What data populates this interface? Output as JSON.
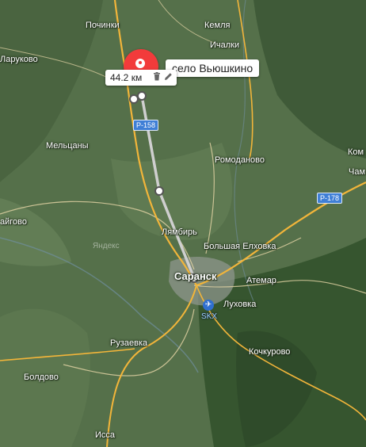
{
  "map": {
    "places": [
      {
        "id": "pochinki",
        "name": "Починки"
      },
      {
        "id": "kemlya",
        "name": "Кемля"
      },
      {
        "id": "ichalki",
        "name": "Ичалки"
      },
      {
        "id": "larukovo",
        "name": "Ларуково"
      },
      {
        "id": "meltsany",
        "name": "Мельцаны"
      },
      {
        "id": "romodanovo",
        "name": "Ромоданово"
      },
      {
        "id": "kom",
        "name": "Ком"
      },
      {
        "id": "cham",
        "name": "Чам"
      },
      {
        "id": "aygovo",
        "name": "айгово"
      },
      {
        "id": "lyambir",
        "name": "Лямбирь"
      },
      {
        "id": "bolshaya-elkovka",
        "name": "Большая Елховка"
      },
      {
        "id": "saransk",
        "name": "Саранск"
      },
      {
        "id": "atemar",
        "name": "Атемар"
      },
      {
        "id": "lukhovka",
        "name": "Луховка"
      },
      {
        "id": "ruzaevka",
        "name": "Рузаевка"
      },
      {
        "id": "kochkurovo",
        "name": "Кочкурово"
      },
      {
        "id": "boldovo",
        "name": "Болдово"
      },
      {
        "id": "issa",
        "name": "Исса"
      }
    ],
    "road_shields": [
      {
        "id": "r158",
        "label": "Р-158"
      },
      {
        "id": "r178",
        "label": "Р-178"
      }
    ],
    "airport_code": "SKX",
    "watermark": "Яндекс"
  },
  "route": {
    "distance_label": "44.2 км",
    "destination_label": "село Вьюшкино",
    "delete_icon": "trash-icon",
    "edit_icon": "pencil-icon"
  },
  "colors": {
    "route_line": "#c9c9c9",
    "pin": "#f23b3b",
    "road_major": "#f2b53a",
    "road_minor": "#e6d6a6",
    "city_area": "#9aa4a0"
  }
}
